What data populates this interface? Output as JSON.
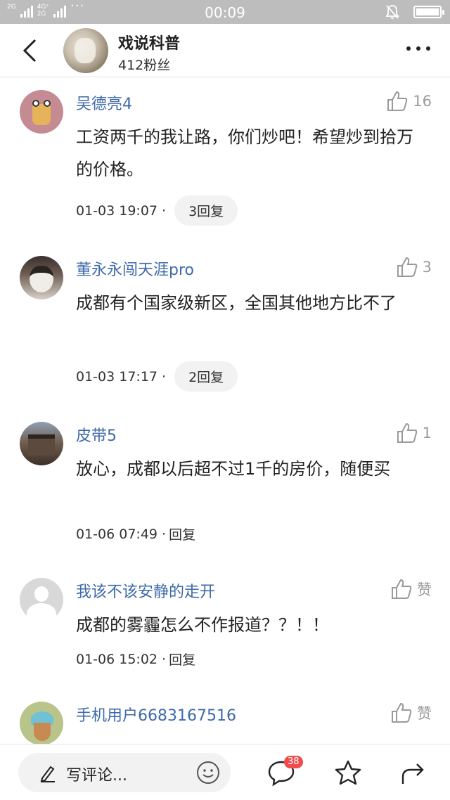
{
  "status_bar": {
    "network_1": "2G",
    "network_2_top": "4G⁺",
    "network_2_mid": "4G",
    "network_2_bottom": "2G",
    "time": "00:09"
  },
  "header": {
    "title": "戏说科普",
    "followers": "412粉丝"
  },
  "comments": [
    {
      "name": "吴德亮4",
      "likes": "16",
      "text": "工资两千的我让路，你们炒吧！希望炒到拾万的价格。",
      "date": "01-03 19:07 ·",
      "reply": "3回复"
    },
    {
      "name": "董永永闯天涯pro",
      "likes": "3",
      "text": "成都有个国家级新区，全国其他地方比不了",
      "date": "01-03 17:17 ·",
      "reply": "2回复"
    },
    {
      "name": "皮带5",
      "likes": "1",
      "text": "放心，成都以后超不过1千的房价，随便买",
      "date": "01-06 07:49 ·",
      "reply": "回复"
    },
    {
      "name": "我该不该安静的走开",
      "likes": "赞",
      "text": "成都的雾霾怎么不作报道？？！！",
      "date": "01-06 15:02 ·",
      "reply": "回复"
    },
    {
      "name": "手机用户6683167516",
      "likes": "赞"
    }
  ],
  "bottom_bar": {
    "input_placeholder": "写评论...",
    "comment_badge": "38"
  },
  "colors": {
    "status_bar": "#bdbdbd",
    "username": "#3e6aa8",
    "badge": "#f04c4c",
    "reply_pill": "#f2f2f2"
  },
  "icons": [
    "back-icon",
    "more-icon",
    "thumbs-up-icon",
    "pen-icon",
    "emoji-icon",
    "comment-icon",
    "star-icon",
    "share-icon",
    "bell-off-icon",
    "battery-icon"
  ]
}
